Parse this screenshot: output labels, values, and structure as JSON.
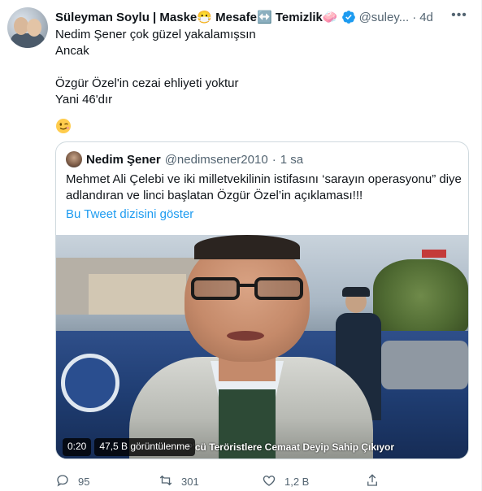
{
  "author": {
    "name": "Süleyman Soylu | Maske😷 Mesafe↔️ Temizlik🧼",
    "handle": "@suley...",
    "separator": "·",
    "time": "4d",
    "verified": true
  },
  "more_label": "•••",
  "tweet_lines": [
    "Nedim Şener çok güzel yakalamışsın",
    "Ancak",
    "",
    "Özgür Özel'in cezai ehliyeti yoktur",
    "Yani 46'dır"
  ],
  "emoji_icon": "winking-face-icon",
  "quoted": {
    "name": "Nedim Şener",
    "handle": "@nedimsener2010",
    "separator": "·",
    "time": "1 sa",
    "text": "Mehmet Ali Çelebi ve iki milletvekilinin istifasını ‘sarayın operasyonu” diye adlandıran ve linci başlatan Özgür Özel’in açıklaması!!!",
    "thread_link": "Bu Tweet dizisini göster",
    "video": {
      "duration": "0:20",
      "views": "47,5 B görüntülenme",
      "caption": "P'cü Teröristlere Cemaat Deyip Sahip Çıkıyor"
    }
  },
  "actions": {
    "reply_count": "95",
    "retweet_count": "301",
    "like_count": "1,2 B",
    "share_label": ""
  },
  "colors": {
    "accent": "#1d9bf0",
    "secondary_text": "#536471",
    "border": "#cfd9de"
  }
}
